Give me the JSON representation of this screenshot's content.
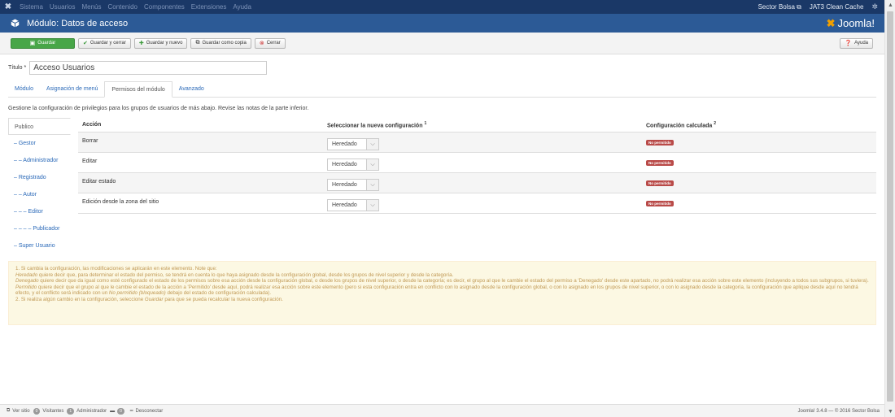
{
  "topbar": {
    "menu": [
      "Sistema",
      "Usuarios",
      "Menús",
      "Contenido",
      "Componentes",
      "Extensiones",
      "Ayuda"
    ],
    "site_link": "Sector Bolsa ⧉",
    "cache_link": "JAT3 Clean Cache"
  },
  "header": {
    "title": "Módulo: Datos de acceso",
    "brand": "Joomla!"
  },
  "toolbar": {
    "save": "Guardar",
    "save_close": "Guardar y cerrar",
    "save_new": "Guardar y nuevo",
    "save_copy": "Guardar como copia",
    "close": "Cerrar",
    "help": "Ayuda"
  },
  "form": {
    "title_label": "Título *",
    "title_value": "Acceso Usuarios"
  },
  "tabs": [
    "Módulo",
    "Asignación de menú",
    "Permisos del módulo",
    "Avanzado"
  ],
  "intro": "Gestione la configuración de privilegios para los grupos de usuarios de más abajo. Revise las notas de la parte inferior.",
  "groups": [
    "Publico",
    "– Gestor",
    "– – Administrador",
    "– Registrado",
    "– – Autor",
    "– – – Editor",
    "– – – – Publicador",
    "– Super Usuario"
  ],
  "permissions": {
    "headers": {
      "action": "Acción",
      "new_setting": "Seleccionar la nueva configuración",
      "new_setting_sup": "1",
      "calculated": "Configuración calculada",
      "calculated_sup": "2"
    },
    "rows": [
      {
        "action": "Borrar",
        "setting": "Heredado",
        "calculated": "No permitido"
      },
      {
        "action": "Editar",
        "setting": "Heredado",
        "calculated": "No permitido"
      },
      {
        "action": "Editar estado",
        "setting": "Heredado",
        "calculated": "No permitido"
      },
      {
        "action": "Edición desde la zona del sitio",
        "setting": "Heredado",
        "calculated": "No permitido"
      }
    ]
  },
  "notes": {
    "l1": "1. Si cambia la configuración, las modificaciones se aplicarán en este elemento. Note que:",
    "l2a": "Heredado",
    "l2b": " quiere decir que, para determinar el estado del permiso, se tendrá en cuenta lo que haya asignado desde la configuración global, desde los grupos de nivel superior y desde la categoría.",
    "l3a": "Denegado",
    "l3b": " quiere decir que da igual como esté configurado el estado de los permisos sobre esa acción desde la configuración global, o desde los grupos de nivel superior, o desde la categoría; es decir, el grupo al que le cambie el estado del permiso a 'Denegado' desde este apartado, no podrá realizar esa acción sobre este elemento (incluyendo a todos sus subgrupos, si tuviera).",
    "l4a": "Permitido",
    "l4b": " quiere decir que el grupo al que le cambie el estado de la acción a 'Permitido' desde aquí, podrá realizar esa acción sobre este elemento (pero si esta configuración entra en conflicto con lo asignado desde la configuración global, o con lo asignado en los grupos de nivel superior, o con lo asignado desde la categoría, la configuración que aplique desde aquí no tendrá efecto, y el conflicto será indicado con un ",
    "l4c": "No permitido (bloqueado)",
    "l4d": " debajo del estado de configuración calculada).",
    "l5a": "2. Si realiza algún cambio en la configuración, seleccione ",
    "l5b": "Guardar",
    "l5c": " para que se pueda recalcular la nueva configuración."
  },
  "statusbar": {
    "view_site": "Ver sitio",
    "visitors_count": "0",
    "visitors_label": "Visitantes",
    "admins_count": "1",
    "admins_label": "Administrador",
    "messages_count": "0",
    "logout": "Desconectar",
    "copyright": "Joomla! 3.4.8 — © 2016 Sector Bolsa"
  },
  "colors": {
    "topbar": "#1a3867",
    "titlebar": "#2c5a96",
    "save_button": "#48a648",
    "badge_denied": "#b94a48",
    "notes_bg": "#fcf8e3"
  },
  "icons": {
    "joomla": "joomla-icon",
    "cube": "cube-icon",
    "cog": "gear-icon"
  }
}
